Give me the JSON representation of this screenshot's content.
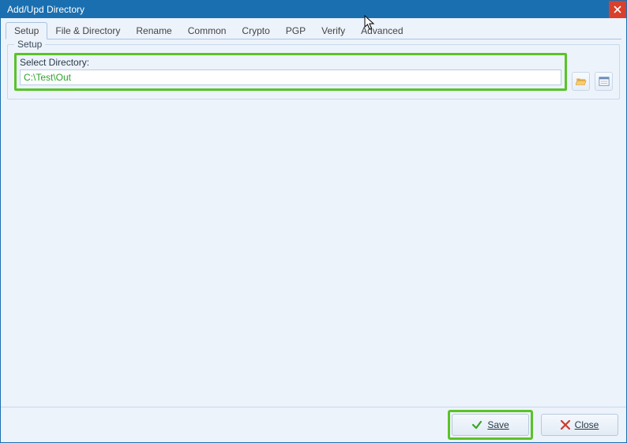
{
  "window": {
    "title": "Add/Upd Directory"
  },
  "tabs": [
    {
      "id": "setup",
      "label": "Setup",
      "active": true
    },
    {
      "id": "filedir",
      "label": "File & Directory"
    },
    {
      "id": "rename",
      "label": "Rename"
    },
    {
      "id": "common",
      "label": "Common"
    },
    {
      "id": "crypto",
      "label": "Crypto"
    },
    {
      "id": "pgp",
      "label": "PGP"
    },
    {
      "id": "verify",
      "label": "Verify"
    },
    {
      "id": "advanced",
      "label": "Advanced"
    }
  ],
  "group": {
    "title": "Setup",
    "select_label": "Select Directory:",
    "path_value": "C:\\Test\\Out"
  },
  "buttons": {
    "save": "Save",
    "close": "Close"
  },
  "icons": {
    "browse": "folder-open-icon",
    "details": "details-pane-icon",
    "close_x": "close-icon",
    "check": "check-icon",
    "red_x": "red-x-icon"
  },
  "colors": {
    "highlight": "#59c328",
    "titlebar": "#1a6fb0",
    "close_btn": "#d9412c",
    "input_text": "#2aa32a"
  }
}
